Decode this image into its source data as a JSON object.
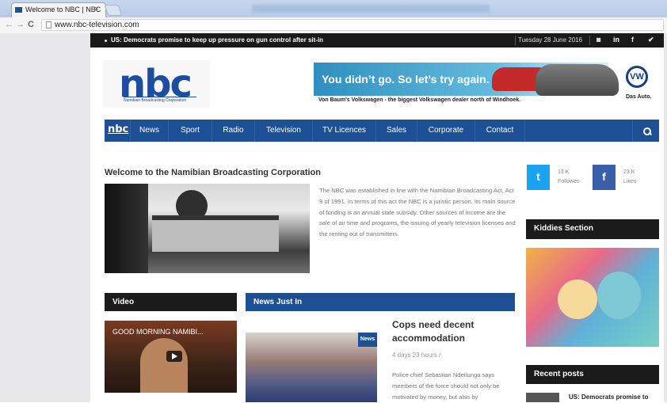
{
  "browser": {
    "tab_title": "Welcome to NBC | NBC",
    "tab_close": "×",
    "url": "www.nbc-television.com",
    "back": "←",
    "forward": "→",
    "reload": "C"
  },
  "topbar": {
    "ticker": "US: Democrats promise to keep up pressure on gun control after sit-in",
    "date": "Tuesday 28 June 2016",
    "social": [
      "◙",
      "in",
      "f",
      "✔"
    ]
  },
  "header": {
    "logo": "nbc",
    "logo_sub": "Namibian Broadcasting Corporation",
    "ad": {
      "headline": "You didn’t go. So let’s try again.",
      "subline": "Von Baum's Volkswagen - the biggest Volkswagen dealer north of Windhoek.",
      "vw_mark": "VW",
      "brand": "Das Auto."
    }
  },
  "nav": {
    "logo": "nbc",
    "items": [
      "News",
      "Sport",
      "Radio",
      "Television",
      "TV Licences",
      "Sales",
      "Corporate",
      "Contact"
    ]
  },
  "welcome": {
    "title": "Welcome to the Namibian Broadcasting Corporation",
    "text": "The NBC was established in line with the Namibian Broadcasting Act, Act 9 of 1991. In terms of this act the NBC is a juristic person. Its main source of funding is an annual state subsidy. Other sources of income are the sale of air time and programs, the issuing of yearly television licenses and the renting out of transmitters."
  },
  "sidebar": {
    "twitter": {
      "glyph": "t",
      "count": "13 K",
      "label": "Followes"
    },
    "facebook": {
      "glyph": "f",
      "count": "23 K",
      "label": "Likes"
    },
    "kiddies_title": "Kiddies Section",
    "recent_title": "Recent posts",
    "recent_item": "US: Democrats promise to"
  },
  "video": {
    "title": "Video",
    "thumb_title": "GOOD MORNING NAMIBI..."
  },
  "news": {
    "title": "News Just In",
    "badge": "News",
    "headline": "Cops need decent accommodation",
    "meta": "4 days 23 hours /",
    "excerpt": "Police chief Sebastian Ndeitunga says members of the force should not only be motivated by money, but also by"
  },
  "colors": {
    "nav_blue": "#1d4f94",
    "dark_bar": "#1b1b1b",
    "twitter": "#1da1f2",
    "facebook": "#3b5ea8"
  }
}
